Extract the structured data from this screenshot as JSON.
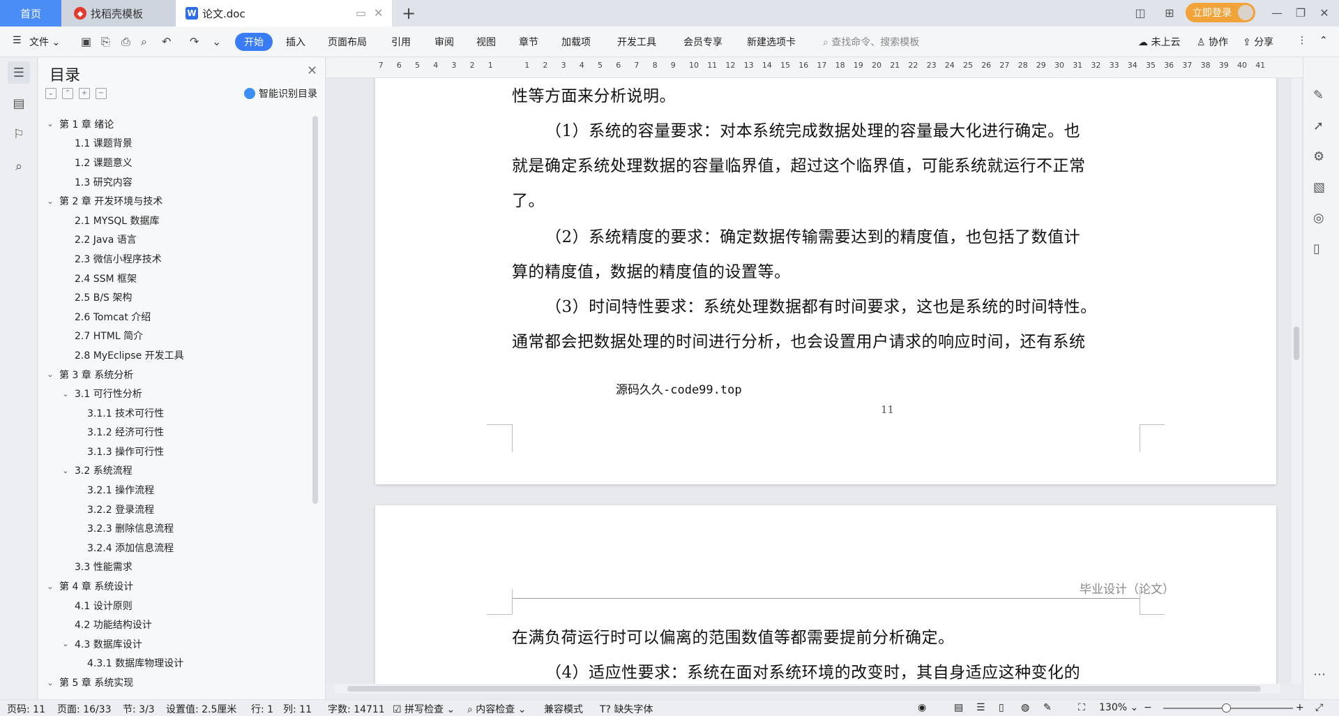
{
  "titlebar": {
    "tabs": [
      {
        "label": "首页"
      },
      {
        "label": "找稻壳模板"
      },
      {
        "label": "论文.doc"
      }
    ],
    "login_label": "立即登录"
  },
  "ribbon": {
    "file_label": "文件",
    "active_tab": "开始",
    "tabs": [
      "插入",
      "页面布局",
      "引用",
      "审阅",
      "视图",
      "章节",
      "加载项",
      "开发工具",
      "会员专享",
      "新建选项卡"
    ],
    "search_placeholder": "查找命令、搜索模板",
    "cloud_label": "未上云",
    "collab_label": "协作",
    "share_label": "分享"
  },
  "toc": {
    "title": "目录",
    "smart_label": "智能识别目录",
    "items": [
      {
        "label": "第 1 章  绪论",
        "level": 1,
        "expanded": true
      },
      {
        "label": "1.1  课题背景",
        "level": 2
      },
      {
        "label": "1.2  课题意义",
        "level": 2
      },
      {
        "label": "1.3  研究内容",
        "level": 2
      },
      {
        "label": "第 2 章  开发环境与技术",
        "level": 1,
        "expanded": true
      },
      {
        "label": "2.1 MYSQL 数据库",
        "level": 2
      },
      {
        "label": "2.2 Java 语言",
        "level": 2
      },
      {
        "label": "2.3  微信小程序技术",
        "level": 2
      },
      {
        "label": "2.4 SSM 框架",
        "level": 2
      },
      {
        "label": "2.5 B/S 架构",
        "level": 2
      },
      {
        "label": "2.6 Tomcat  介绍",
        "level": 2
      },
      {
        "label": "2.7 HTML 简介",
        "level": 2
      },
      {
        "label": "2.8 MyEclipse 开发工具",
        "level": 2
      },
      {
        "label": "第 3 章  系统分析",
        "level": 1,
        "expanded": true
      },
      {
        "label": "3.1  可行性分析",
        "level": 2,
        "expanded": true
      },
      {
        "label": "3.1.1  技术可行性",
        "level": 3
      },
      {
        "label": "3.1.2  经济可行性",
        "level": 3
      },
      {
        "label": "3.1.3  操作可行性",
        "level": 3
      },
      {
        "label": "3.2  系统流程",
        "level": 2,
        "expanded": true
      },
      {
        "label": "3.2.1  操作流程",
        "level": 3
      },
      {
        "label": "3.2.2  登录流程",
        "level": 3
      },
      {
        "label": "3.2.3  删除信息流程",
        "level": 3
      },
      {
        "label": "3.2.4  添加信息流程",
        "level": 3
      },
      {
        "label": "3.3  性能需求",
        "level": 2
      },
      {
        "label": "第 4 章  系统设计",
        "level": 1,
        "expanded": true
      },
      {
        "label": "4.1  设计原则",
        "level": 2
      },
      {
        "label": "4.2  功能结构设计",
        "level": 2
      },
      {
        "label": "4.3  数据库设计",
        "level": 2,
        "expanded": true
      },
      {
        "label": "4.3.1  数据库物理设计",
        "level": 3
      },
      {
        "label": "第 5 章  系统实现",
        "level": 1,
        "expanded": true
      }
    ]
  },
  "ruler": {
    "left_ticks": [
      "7",
      "6",
      "5",
      "4",
      "3",
      "2",
      "1"
    ],
    "right_ticks": [
      "1",
      "2",
      "3",
      "4",
      "5",
      "6",
      "7",
      "8",
      "9",
      "10",
      "11",
      "12",
      "13",
      "14",
      "15",
      "16",
      "17",
      "18",
      "19",
      "20",
      "21",
      "22",
      "23",
      "24",
      "25",
      "26",
      "27",
      "28",
      "29",
      "30",
      "31",
      "32",
      "33",
      "34",
      "35",
      "36",
      "37",
      "38",
      "39",
      "40",
      "41"
    ]
  },
  "document": {
    "page1_lines": [
      "性等方面来分析说明。",
      "（1）系统的容量要求：对本系统完成数据处理的容量最大化进行确定。也",
      "就是确定系统处理数据的容量临界值，超过这个临界值，可能系统就运行不正常",
      "了。",
      "（2）系统精度的要求：确定数据传输需要达到的精度值，也包括了数值计",
      "算的精度值，数据的精度值的设置等。",
      "（3）时间特性要求：系统处理数据都有时间要求，这也是系统的时间特性。",
      "通常都会把数据处理的时间进行分析，也会设置用户请求的响应时间，还有系统"
    ],
    "footer_source": "源码久久-code99.top",
    "page_number": "11",
    "page2_header": "毕业设计（论文）",
    "page2_lines": [
      "在满负荷运行时可以偏离的范围数值等都需要提前分析确定。",
      "（4）适应性要求：系统在面对系统环境的改变时，其自身适应这种变化的"
    ]
  },
  "status": {
    "page_code": "页码: 11",
    "page": "页面: 16/33",
    "section": "节: 3/3",
    "setting": "设置值: 2.5厘米",
    "row": "行: 1",
    "col": "列: 11",
    "words": "字数: 14711",
    "spell": "拼写检查",
    "content_check": "内容检查",
    "compat": "兼容模式",
    "missing_font": "缺失字体",
    "zoom": "130%"
  }
}
